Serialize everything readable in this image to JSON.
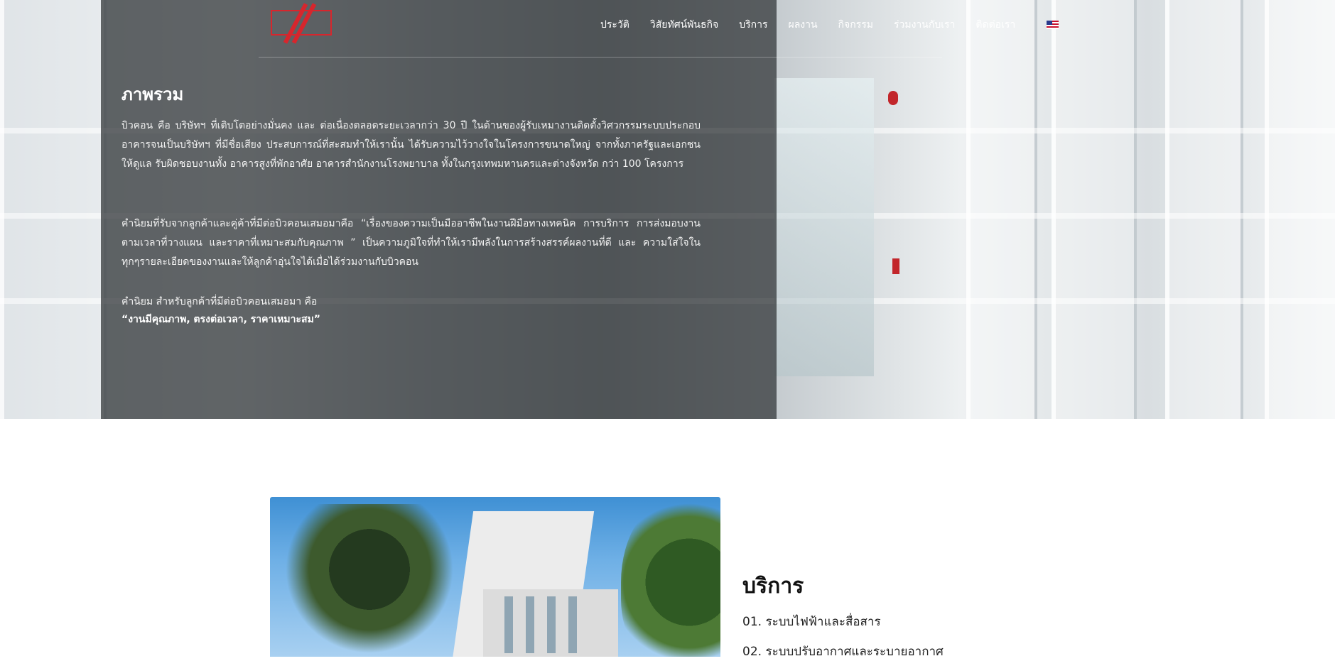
{
  "nav": {
    "items": [
      "ประวัติ",
      "วิสัยทัศน์พันธกิจ",
      "บริการ",
      "ผลงาน",
      "กิจกรรม",
      "ร่วมงานกับเรา",
      "ติดต่อเรา"
    ],
    "language_flag": "us-flag-icon"
  },
  "hero": {
    "title": "ภาพรวม",
    "paragraph1": "บิวคอน คือ บริษัทฯ ที่เติบโตอย่างมั่นคง และ ต่อเนื่องตลอดระยะเวลากว่า 30 ปี ในด้านของผู้รับเหมางานติดตั้งวิศวกรรมระบบประกอบอาคารจนเป็นบริษัทฯ ที่มีชื่อเสียง ประสบการณ์ที่สะสมทำให้เรานั้น ได้รับความไว้วางใจในโครงการขนาดใหญ่ จากทั้งภาครัฐและเอกชนให้ดูแล รับผิดชอบงานทั้ง อาคารสูงที่พักอาศัย อาคารสำนักงานโรงพยาบาล ทั้งในกรุงเทพมหานครและต่างจังหวัด กว่า 100 โครงการ",
    "paragraph2": "คำนิยมที่รับจากลูกค้าและคู่ค้าที่มีต่อบิวคอนเสมอมาคือ “เรื่องของความเป็นมืออาชีพในงานฝีมือทางเทคนิค การบริการ การส่งมอบงานตามเวลาที่วางแผน และราคาที่เหมาะสมกับคุณภาพ ” เป็นความภูมิใจที่ทำให้เรามีพลังในการสร้างสรรค์ผลงานที่ดี และ ความใส่ใจในทุกๆรายละเอียดของงานและให้ลูกค้าอุ่นใจได้เมื่อได้ร่วมงานกับบิวคอน",
    "paragraph3": "คำนิยม สำหรับลูกค้าที่มีต่อบิวคอนเสมอมา คือ",
    "paragraph3_bold": "“งานมีคุณภาพ, ตรงต่อเวลา, ราคาเหมาะสม”"
  },
  "services": {
    "title": "บริการ",
    "items": [
      "01. ระบบไฟฟ้าและสื่อสาร",
      "02. ระบบปรับอากาศและระบายอากาศ"
    ]
  },
  "colors": {
    "brand_red": "#d7262d",
    "overlay": "#3a3e40"
  }
}
